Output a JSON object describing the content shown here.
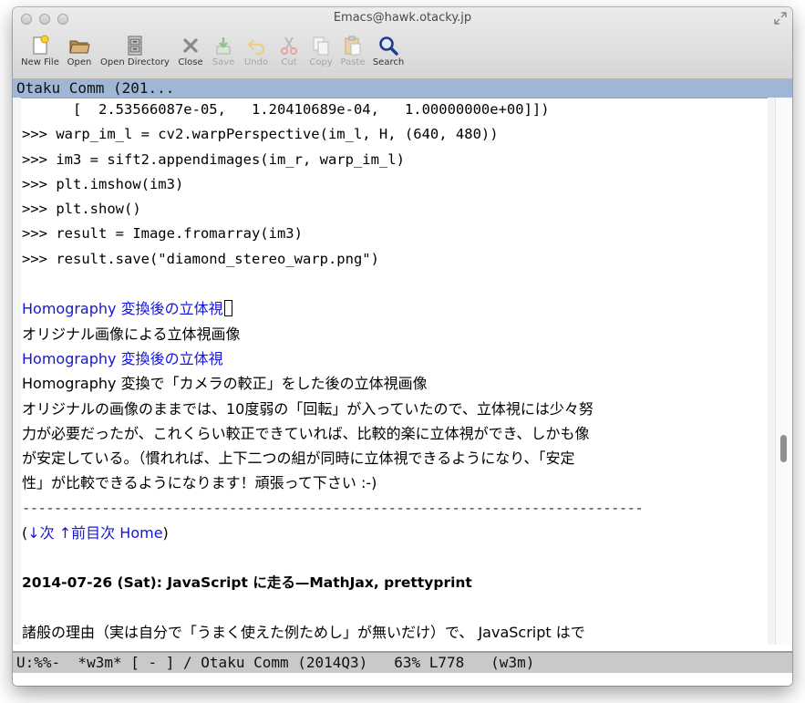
{
  "window": {
    "title": "Emacs@hawk.otacky.jp"
  },
  "toolbar": {
    "items": [
      {
        "label": "New File",
        "icon": "new-file-icon",
        "enabled": true
      },
      {
        "label": "Open",
        "icon": "folder-open-icon",
        "enabled": true
      },
      {
        "label": "Open Directory",
        "icon": "cabinet-icon",
        "enabled": true
      },
      {
        "label": "Close",
        "icon": "close-icon",
        "enabled": true
      },
      {
        "label": "Save",
        "icon": "save-icon",
        "enabled": false
      },
      {
        "label": "Undo",
        "icon": "undo-icon",
        "enabled": false
      },
      {
        "label": "Cut",
        "icon": "scissors-icon",
        "enabled": false
      },
      {
        "label": "Copy",
        "icon": "copy-icon",
        "enabled": false
      },
      {
        "label": "Paste",
        "icon": "paste-icon",
        "enabled": false
      },
      {
        "label": "Search",
        "icon": "magnifier-icon",
        "enabled": true
      }
    ]
  },
  "buffer": {
    "header": "Otaku Comm (201...",
    "lines": [
      "      [  2.53566087e-05,   1.20410689e-04,   1.00000000e+00]])",
      ">>> warp_im_l = cv2.warpPerspective(im_l, H, (640, 480))",
      ">>> im3 = sift2.appendimages(im_r, warp_im_l)",
      ">>> plt.imshow(im3)",
      ">>> plt.show()",
      ">>> result = Image.fromarray(im3)",
      ">>> result.save(\"diamond_stereo_warp.png\")",
      "",
      "Homography 変換後の立体視",
      "オリジナル画像による立体視画像",
      "Homography 変換後の立体視",
      "Homography 変換で「カメラの較正」をした後の立体視画像",
      "オリジナルの画像のままでは、10度弱の「回転」が入っていたので、立体視には少々努",
      "力が必要だったが、これくらい較正できていれば、比較的楽に立体視ができ、しかも像",
      "が安定している。（慣れれば、上下二つの組が同時に立体視できるようになり、「安定",
      "性」が比較できるようになります！頑張って下さい :-)",
      "------------------------------------------------------------------------------",
      "",
      "",
      "2014-07-26 (Sat): JavaScript に走る—MathJax, prettyprint",
      "",
      "諸般の理由（実は自分で「うまく使えた例ためし」が無いだけ）で、 JavaScript はで"
    ],
    "nav": {
      "open": "(",
      "next": "↓次",
      "prev": "↑前目次",
      "home": "Home",
      "close": ")"
    }
  },
  "modeline": "U:%%-  *w3m* [ - ] / Otaku Comm (2014Q3)   63% L778   (w3m)",
  "scroll": {
    "position_fraction": 0.63
  }
}
